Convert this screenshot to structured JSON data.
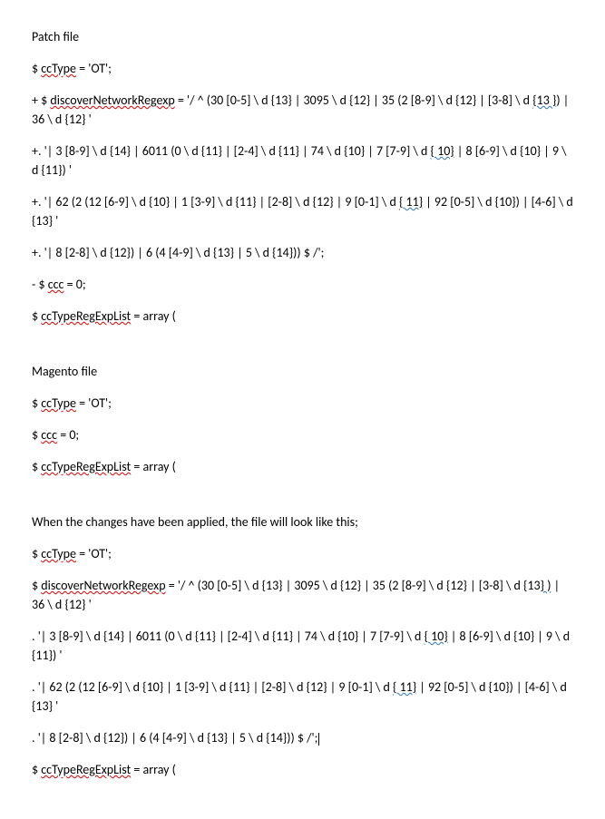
{
  "section1": {
    "title": "Patch file",
    "line1_a": "$ ",
    "line1_b": "ccType",
    "line1_c": " = 'OT';",
    "line2_a": "+ $ ",
    "line2_b": "discoverNetworkRegexp",
    "line2_c": " = '/ ^ (30 [0-5] \\ d {13} | 3095 \\ d {12} | 35 (2 [8-9] \\ d {12} | [3-8] \\ d ",
    "line2_d": "{13 }",
    "line2_e": ") | 36 \\ d {12} '",
    "line3_a": "+. '| 3 [8-9] \\ d {14} | 6011 (0 \\ d {11} | [2-4] \\ d {11} | 74 \\ d {10} | 7 [7-9] \\ d ",
    "line3_b": "{ 10}",
    "line3_c": " | 8 [6-9] \\ d {10} | 9 \\ d {11}) '",
    "line4_a": "+. '| 62 (2 (12 [6-9] \\ d {10} | 1 [3-9] \\ d {11} | [2-8] \\ d {12} | 9 [0-1] \\ d ",
    "line4_b": "{ 11}",
    "line4_c": " | 92 [0-5] \\ d {10}) | [4-6] \\ d {13} '",
    "line5": "+. '| 8 [2-8] \\ d {12}) | 6 (4 [4-9] \\ d {13} | 5 \\ d {14})) $ /';",
    "line6_a": "- $ ",
    "line6_b": "ccc",
    "line6_c": " = 0;",
    "line7_a": "$ ",
    "line7_b": "ccTypeRegExpList",
    "line7_c": " = array ("
  },
  "section2": {
    "title": "Magento file",
    "line1_a": "$ ",
    "line1_b": "ccType",
    "line1_c": " = 'OT';",
    "line2_a": "$ ",
    "line2_b": "ccc",
    "line2_c": " = 0;",
    "line3_a": "$ ",
    "line3_b": "ccTypeRegExpList",
    "line3_c": " = array ("
  },
  "section3": {
    "title": "When the changes have been applied, the file will look like this;",
    "line1_a": "$ ",
    "line1_b": "ccType",
    "line1_c": " = 'OT';",
    "line2_a": "$ ",
    "line2_b": "discoverNetworkRegexp",
    "line2_c": " = '/ ^ (30 [0-5] \\ d {13} | 3095 \\ d {12} | 35 (2 [8-9] \\ d {12} | [3-8] \\ d {13",
    "line2_d": "} )",
    "line2_e": " | 36 \\ d {12} '",
    "line3_a": ". '| 3 [8-9] \\ d {14} | 6011 (0 \\ d {11} | [2-4] \\ d {11} | 74 \\ d {10} | 7 [7-9] \\ d ",
    "line3_b": "{ 10}",
    "line3_c": " | 8 [6-9] \\ d {10} | 9 \\ d {11}) '",
    "line4_a": ". '| 62 (2 (12 [6-9] \\ d {10} | 1 [3-9] \\ d {11} | [2-8] \\ d {12} | 9 [0-1] \\ d ",
    "line4_b": "{ 11}",
    "line4_c": " | 92 [0-5] \\ d {10}) | [4-6] \\ d {13} '",
    "line5": ". '| 8 [2-8] \\ d {12}) | 6 (4 [4-9] \\ d {13} | 5 \\ d {14})) $ /';",
    "line6_a": "$ ",
    "line6_b": "ccTypeRegExpList",
    "line6_c": " = array ("
  }
}
